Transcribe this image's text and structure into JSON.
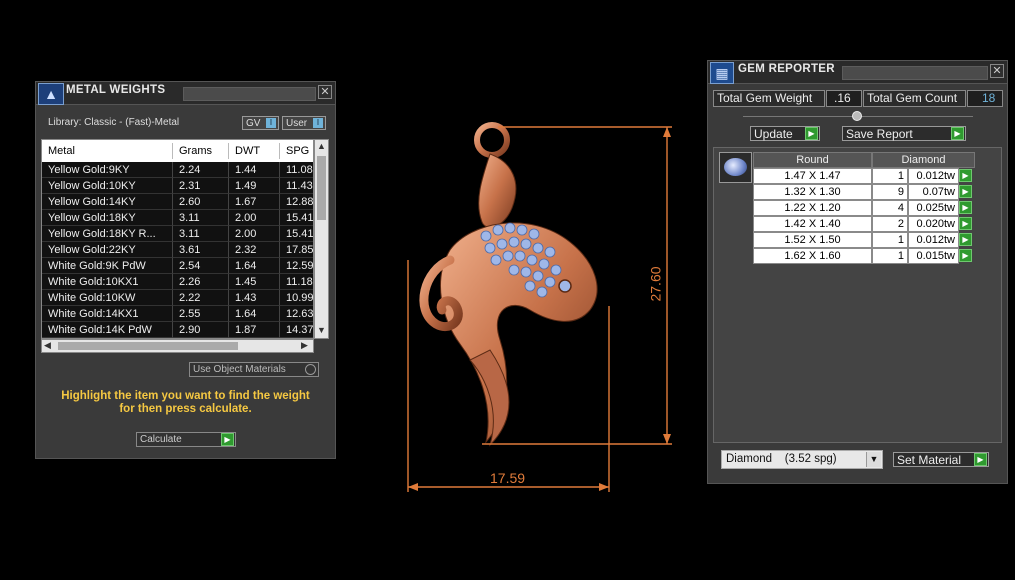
{
  "metal_weights": {
    "title": "METAL WEIGHTS",
    "library_label": "Library: Classic - (Fast)-Metal",
    "gv_label": "GV",
    "user_label": "User",
    "columns": [
      "Metal",
      "Grams",
      "DWT",
      "SPG"
    ],
    "rows": [
      {
        "metal": "Yellow Gold:9KY",
        "grams": "2.24",
        "dwt": "1.44",
        "spg": "11.08"
      },
      {
        "metal": "Yellow Gold:10KY",
        "grams": "2.31",
        "dwt": "1.49",
        "spg": "11.43"
      },
      {
        "metal": "Yellow Gold:14KY",
        "grams": "2.60",
        "dwt": "1.67",
        "spg": "12.88"
      },
      {
        "metal": "Yellow Gold:18KY",
        "grams": "3.11",
        "dwt": "2.00",
        "spg": "15.41"
      },
      {
        "metal": "Yellow Gold:18KY R...",
        "grams": "3.11",
        "dwt": "2.00",
        "spg": "15.41"
      },
      {
        "metal": "Yellow Gold:22KY",
        "grams": "3.61",
        "dwt": "2.32",
        "spg": "17.85"
      },
      {
        "metal": "White Gold:9K PdW",
        "grams": "2.54",
        "dwt": "1.64",
        "spg": "12.59"
      },
      {
        "metal": "White Gold:10KX1",
        "grams": "2.26",
        "dwt": "1.45",
        "spg": "11.18"
      },
      {
        "metal": "White Gold:10KW",
        "grams": "2.22",
        "dwt": "1.43",
        "spg": "10.99"
      },
      {
        "metal": "White Gold:14KX1",
        "grams": "2.55",
        "dwt": "1.64",
        "spg": "12.63"
      },
      {
        "metal": "White Gold:14K PdW",
        "grams": "2.90",
        "dwt": "1.87",
        "spg": "14.37"
      }
    ],
    "use_object_materials_label": "Use Object Materials",
    "hint_line1": "Highlight the item you want to find the weight",
    "hint_line2": "for then press calculate.",
    "calculate_label": "Calculate"
  },
  "viewport": {
    "width_dimension": "17.59",
    "height_dimension": "27.60"
  },
  "gem_reporter": {
    "title": "GEM REPORTER",
    "total_weight_label": "Total Gem Weight",
    "total_weight_value": ".16",
    "total_count_label": "Total Gem Count",
    "total_count_value": "18",
    "update_label": "Update",
    "save_report_label": "Save Report",
    "header_shape": "Round",
    "header_material": "Diamond",
    "rows": [
      {
        "size": "1.47 X 1.47",
        "count": "1",
        "tw": "0.012tw"
      },
      {
        "size": "1.32 X 1.30",
        "count": "9",
        "tw": "0.07tw"
      },
      {
        "size": "1.22 X 1.20",
        "count": "4",
        "tw": "0.025tw"
      },
      {
        "size": "1.42 X 1.40",
        "count": "2",
        "tw": "0.020tw"
      },
      {
        "size": "1.52 X 1.50",
        "count": "1",
        "tw": "0.012tw"
      },
      {
        "size": "1.62 X 1.60",
        "count": "1",
        "tw": "0.015tw"
      }
    ],
    "material_select_value": "Diamond    (3.52 spg)",
    "set_material_label": "Set Material"
  },
  "colors": {
    "accent_yellow": "#f5c842",
    "dimension_orange": "#e07b3a",
    "play_green": "#2f9a2f",
    "rose_gold": "#d98a62",
    "gem_blue": "#9fb7e8"
  }
}
